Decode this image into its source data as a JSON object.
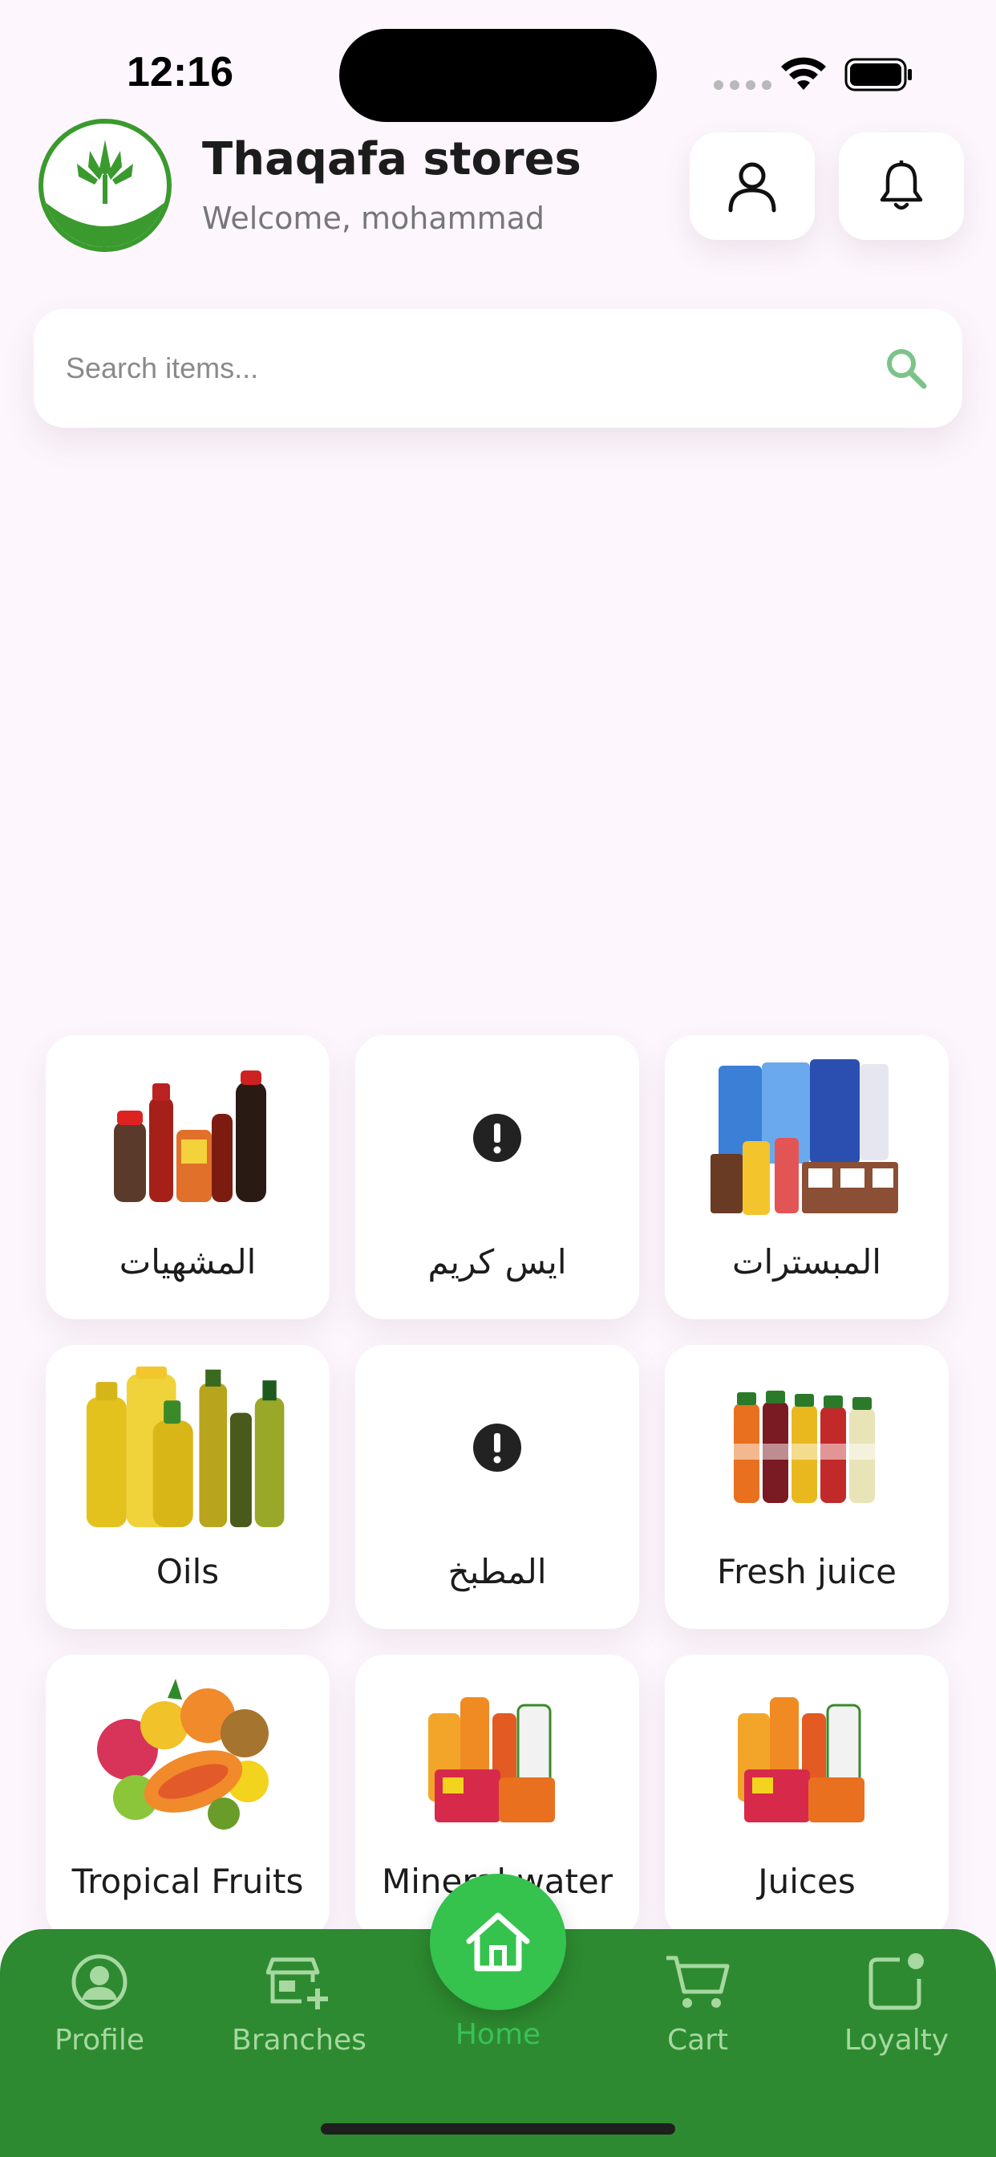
{
  "status_bar": {
    "time": "12:16"
  },
  "header": {
    "title": "Thaqafa stores",
    "subtitle": "Welcome, mohammad"
  },
  "search": {
    "placeholder": "Search items..."
  },
  "categories": [
    {
      "label": "المشهيات",
      "image": "condiments-photo"
    },
    {
      "label": "ايس كريم",
      "image": "missing-image-icon"
    },
    {
      "label": "المبسترات",
      "image": "milk-cartons-photo"
    },
    {
      "label": "Oils",
      "image": "oil-bottles-photo"
    },
    {
      "label": "المطبخ",
      "image": "missing-image-icon"
    },
    {
      "label": "Fresh juice",
      "image": "juice-bottles-photo"
    },
    {
      "label": "Tropical Fruits",
      "image": "fruits-photo"
    },
    {
      "label": "Mineral water",
      "image": "drinks-pack-photo"
    },
    {
      "label": "Juices",
      "image": "drinks-pack-photo"
    }
  ],
  "bottom_nav": {
    "profile": "Profile",
    "branches": "Branches",
    "home": "Home",
    "cart": "Cart",
    "loyalty": "Loyalty"
  },
  "colors": {
    "background": "#fdf6fc",
    "nav_green": "#2d8a30",
    "home_green": "#35c24d",
    "nav_text": "#a6d8a0",
    "accent_search": "#7cc38a"
  }
}
